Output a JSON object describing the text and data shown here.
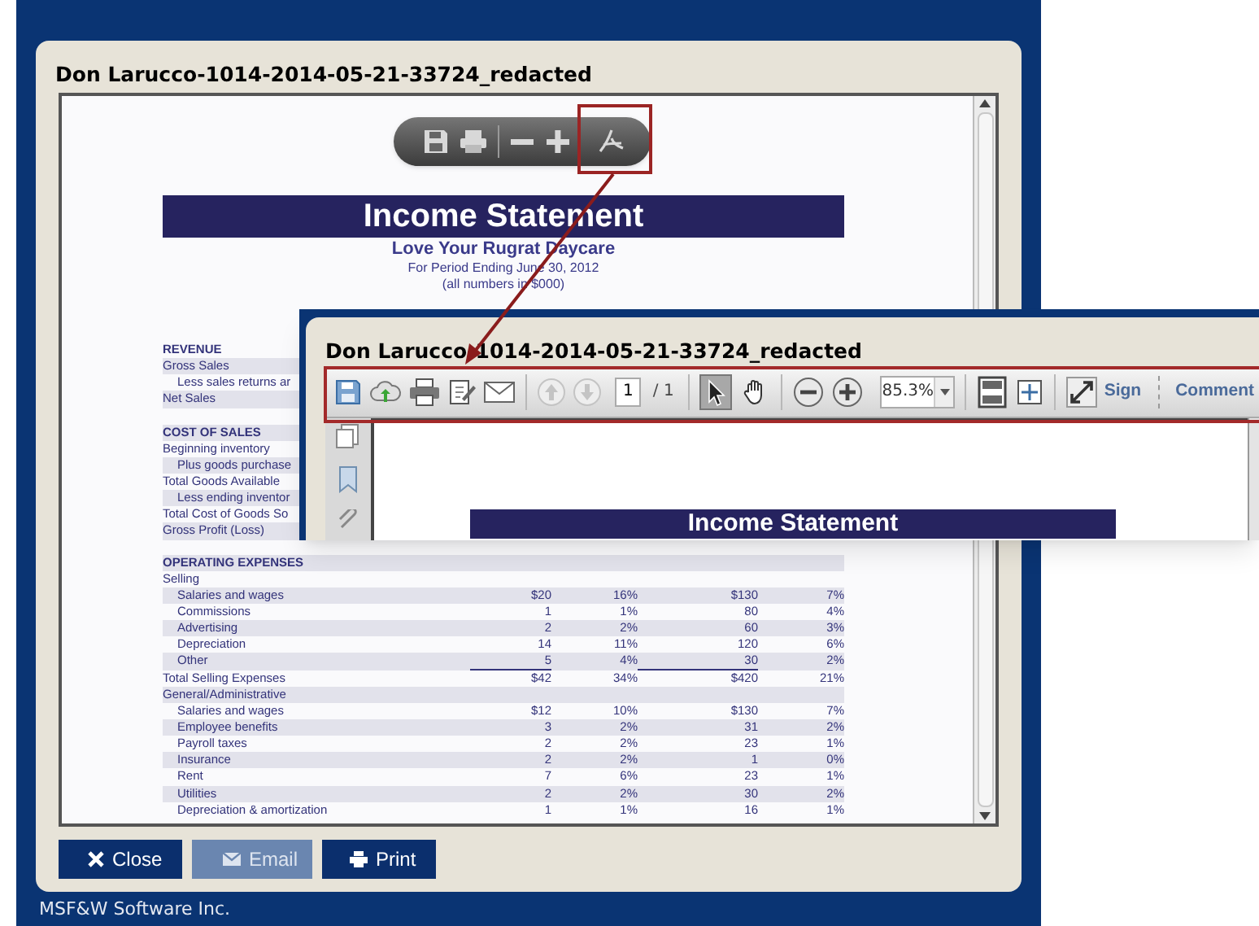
{
  "window": {
    "title": "Don Larucco-1014-2014-05-21-33724_redacted"
  },
  "statement": {
    "heading": "Income Statement",
    "company": "Love Your Rugrat Daycare",
    "period": "For Period Ending June 30, 2012",
    "units": "(all numbers in $000)",
    "rows": [
      {
        "kind": "section",
        "label": "REVENUE",
        "shaded": false
      },
      {
        "kind": "line",
        "label": "Gross Sales",
        "shaded": true
      },
      {
        "kind": "sub",
        "label": "Less sales returns ar",
        "shaded": false
      },
      {
        "kind": "line",
        "label": "Net Sales",
        "shaded": true
      },
      {
        "kind": "section",
        "label": "COST OF SALES",
        "shaded": true
      },
      {
        "kind": "line",
        "label": "Beginning inventory",
        "shaded": false
      },
      {
        "kind": "sub",
        "label": "Plus goods purchase",
        "shaded": true
      },
      {
        "kind": "line",
        "label": "Total Goods Available",
        "shaded": false
      },
      {
        "kind": "sub",
        "label": "Less ending inventor",
        "shaded": true
      },
      {
        "kind": "line",
        "label": "Total Cost of Goods So",
        "shaded": false
      },
      {
        "kind": "line",
        "label": "Gross Profit (Loss)",
        "shaded": true
      },
      {
        "kind": "section",
        "label": "OPERATING EXPENSES",
        "shaded": true
      },
      {
        "kind": "line",
        "label": "Selling",
        "shaded": false
      },
      {
        "kind": "sub",
        "label": "Salaries and wages",
        "shaded": true,
        "cells": [
          "$20",
          "16%",
          "$130",
          "7%"
        ]
      },
      {
        "kind": "sub",
        "label": "Commissions",
        "shaded": false,
        "cells": [
          "1",
          "1%",
          "80",
          "4%"
        ]
      },
      {
        "kind": "sub",
        "label": "Advertising",
        "shaded": true,
        "cells": [
          "2",
          "2%",
          "60",
          "3%"
        ]
      },
      {
        "kind": "sub",
        "label": "Depreciation",
        "shaded": false,
        "cells": [
          "14",
          "11%",
          "120",
          "6%"
        ]
      },
      {
        "kind": "sub",
        "label": "Other",
        "shaded": true,
        "underlined": true,
        "cells": [
          "5",
          "4%",
          "30",
          "2%"
        ]
      },
      {
        "kind": "line",
        "label": "Total Selling Expenses",
        "shaded": false,
        "cells": [
          "$42",
          "34%",
          "$420",
          "21%"
        ]
      },
      {
        "kind": "line",
        "label": "General/Administrative",
        "shaded": true
      },
      {
        "kind": "sub",
        "label": "Salaries and wages",
        "shaded": false,
        "cells": [
          "$12",
          "10%",
          "$130",
          "7%"
        ]
      },
      {
        "kind": "sub",
        "label": "Employee benefits",
        "shaded": true,
        "cells": [
          "3",
          "2%",
          "31",
          "2%"
        ]
      },
      {
        "kind": "sub",
        "label": "Payroll taxes",
        "shaded": false,
        "cells": [
          "2",
          "2%",
          "23",
          "1%"
        ]
      },
      {
        "kind": "sub",
        "label": "Insurance",
        "shaded": true,
        "cells": [
          "2",
          "2%",
          "1",
          "0%"
        ]
      },
      {
        "kind": "sub",
        "label": "Rent",
        "shaded": false,
        "cells": [
          "7",
          "6%",
          "23",
          "1%"
        ]
      },
      {
        "kind": "sub",
        "label": "Utilities",
        "shaded": true,
        "cells": [
          "2",
          "2%",
          "30",
          "2%"
        ]
      },
      {
        "kind": "sub",
        "label": "Depreciation & amortization",
        "shaded": false,
        "cells": [
          "1",
          "1%",
          "16",
          "1%"
        ]
      }
    ]
  },
  "inset": {
    "title": "Don Larucco-1014-2014-05-21-33724_redacted",
    "page_nav": [
      {
        "kind": "previous",
        "disabled": true
      },
      {
        "kind": "next",
        "disabled": true
      }
    ],
    "page_number": "1",
    "page_count": "/ 1",
    "tools": [
      {
        "kind": "select",
        "selected": true
      },
      {
        "kind": "hand",
        "selected": false
      }
    ],
    "zoom": "85.3%",
    "actions": [
      "Sign",
      "Comment"
    ],
    "heading": "Income Statement"
  },
  "buttons": [
    {
      "kind": "close",
      "label": "Close",
      "disabled": false
    },
    {
      "kind": "email",
      "label": "Email",
      "disabled": true
    },
    {
      "kind": "print",
      "label": "Print",
      "disabled": false
    }
  ],
  "footer": "MSF&W Software Inc."
}
